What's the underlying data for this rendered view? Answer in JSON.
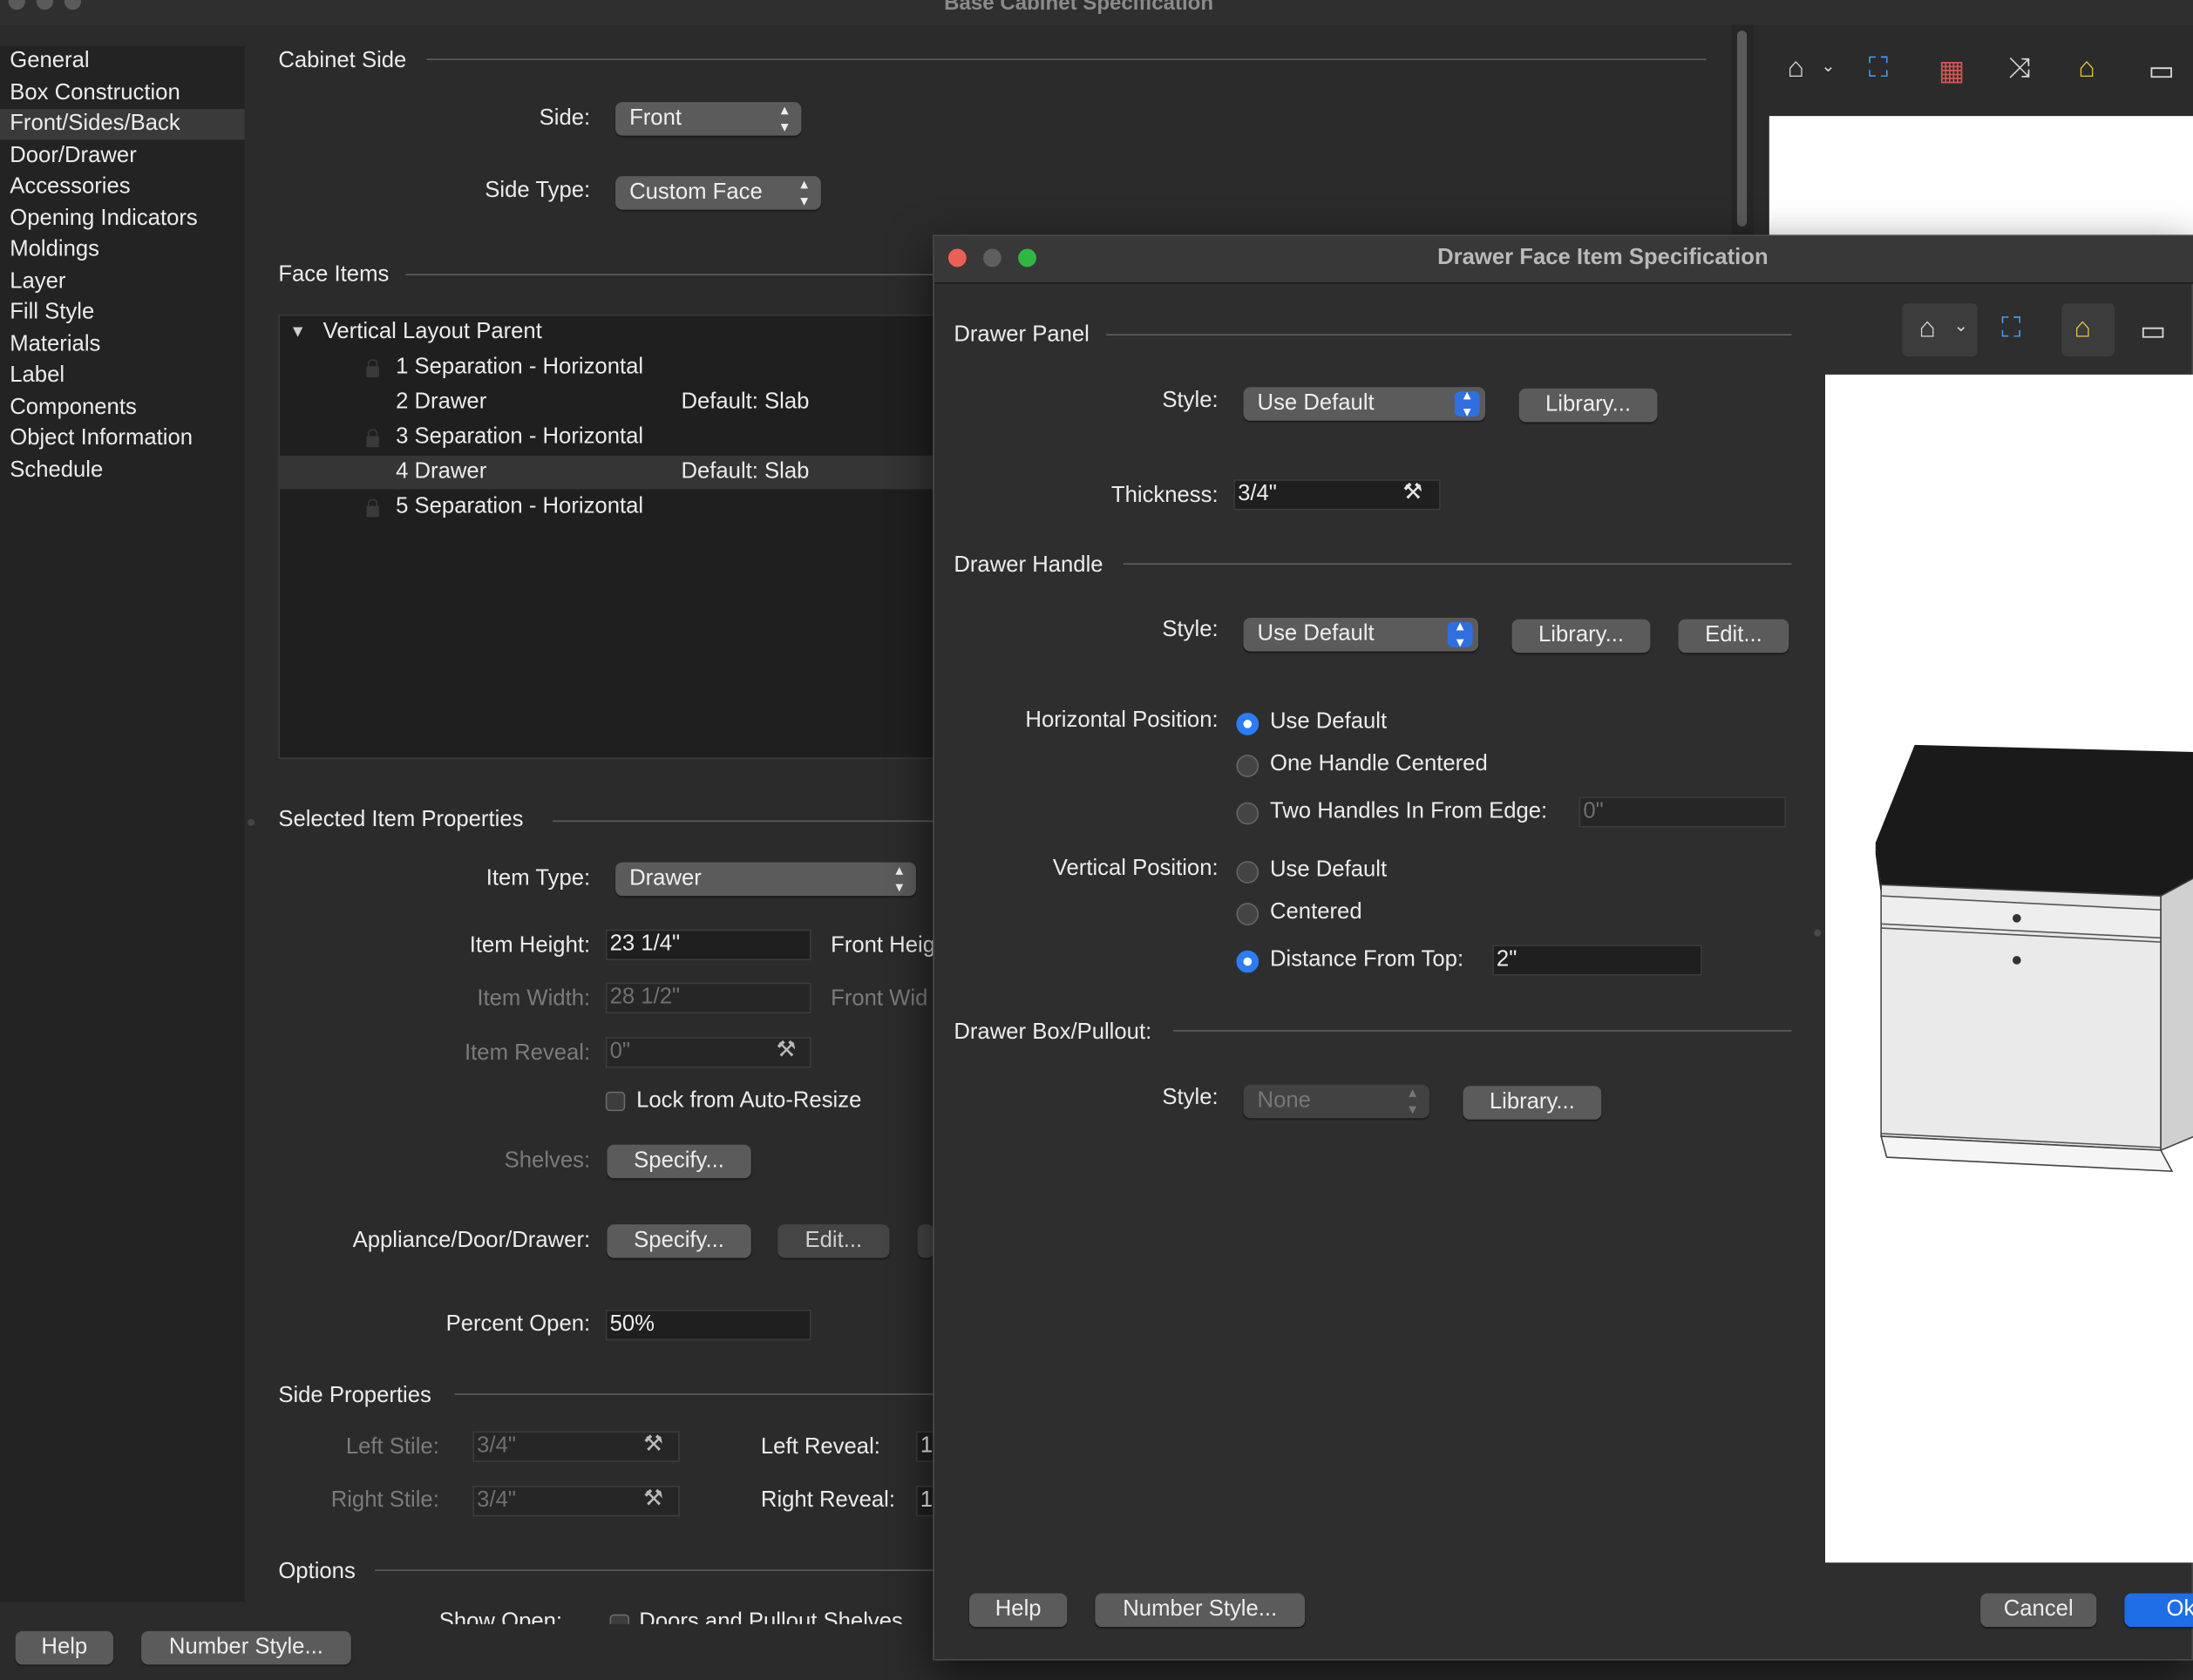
{
  "back_window": {
    "title": "Base Cabinet Specification",
    "sidebar": [
      "General",
      "Box Construction",
      "Front/Sides/Back",
      "Door/Drawer",
      "Accessories",
      "Opening Indicators",
      "Moldings",
      "Layer",
      "Fill Style",
      "Materials",
      "Label",
      "Components",
      "Object Information",
      "Schedule"
    ],
    "selected_sidebar": "Front/Sides/Back",
    "cabinet_side": {
      "section": "Cabinet Side",
      "side_label": "Side:",
      "side_value": "Front",
      "side_type_label": "Side Type:",
      "side_type_value": "Custom Face"
    },
    "face_items": {
      "section": "Face Items",
      "parent": "Vertical Layout Parent",
      "rows": [
        {
          "name": "1 Separation - Horizontal",
          "detail": "",
          "locked": true
        },
        {
          "name": "2 Drawer",
          "detail": "Default: Slab",
          "locked": false
        },
        {
          "name": "3 Separation - Horizontal",
          "detail": "",
          "locked": true
        },
        {
          "name": "4 Drawer",
          "detail": "Default: Slab",
          "locked": false
        },
        {
          "name": "5 Separation - Horizontal",
          "detail": "",
          "locked": true
        }
      ]
    },
    "selected_item": {
      "section": "Selected Item Properties",
      "item_type_label": "Item Type:",
      "item_type_value": "Drawer",
      "item_height_label": "Item Height:",
      "item_height_value": "23 1/4\"",
      "front_height_label": "Front Heig",
      "item_width_label": "Item Width:",
      "item_width_value": "28 1/2\"",
      "front_width_label": "Front Wid",
      "item_reveal_label": "Item Reveal:",
      "item_reveal_value": "0\"",
      "lock_label": "Lock from Auto-Resize",
      "shelves_label": "Shelves:",
      "shelves_button": "Specify...",
      "appliance_label": "Appliance/Door/Drawer:",
      "appliance_specify": "Specify...",
      "appliance_edit": "Edit...",
      "percent_open_label": "Percent Open:",
      "percent_open_value": "50%"
    },
    "side_properties": {
      "section": "Side Properties",
      "left_stile_label": "Left Stile:",
      "left_stile_value": "3/4\"",
      "right_stile_label": "Right Stile:",
      "right_stile_value": "3/4\"",
      "left_reveal_label": "Left Reveal:",
      "left_reveal_value": "1",
      "right_reveal_label": "Right Reveal:",
      "right_reveal_value": "1"
    },
    "options": {
      "section": "Options",
      "show_open_label": "Show Open:",
      "doors_label": "Doors and Pullout Shelves"
    },
    "footer": {
      "help": "Help",
      "number_style": "Number Style..."
    }
  },
  "dialog": {
    "title": "Drawer Face Item Specification",
    "drawer_panel": {
      "section": "Drawer Panel",
      "style_label": "Style:",
      "style_value": "Use Default",
      "library": "Library...",
      "thickness_label": "Thickness:",
      "thickness_value": "3/4\""
    },
    "drawer_handle": {
      "section": "Drawer Handle",
      "style_label": "Style:",
      "style_value": "Use Default",
      "library": "Library...",
      "edit": "Edit...",
      "horizontal_label": "Horizontal Position:",
      "horizontal_options": [
        "Use Default",
        "One Handle Centered",
        "Two Handles In From Edge:"
      ],
      "horizontal_selected": 0,
      "edge_value": "0\"",
      "vertical_label": "Vertical Position:",
      "vertical_options": [
        "Use Default",
        "Centered",
        "Distance From Top:"
      ],
      "vertical_selected": 2,
      "distance_value": "2\""
    },
    "drawer_box": {
      "section": "Drawer Box/Pullout:",
      "style_label": "Style:",
      "style_value": "None",
      "library": "Library..."
    },
    "footer": {
      "help": "Help",
      "number_style": "Number Style...",
      "cancel": "Cancel",
      "ok": "Ok"
    }
  },
  "colors": {
    "accent": "#2c7cf6",
    "close": "#ec5f57",
    "minimize": "#5f5f5f",
    "zoom": "#2eb843"
  }
}
